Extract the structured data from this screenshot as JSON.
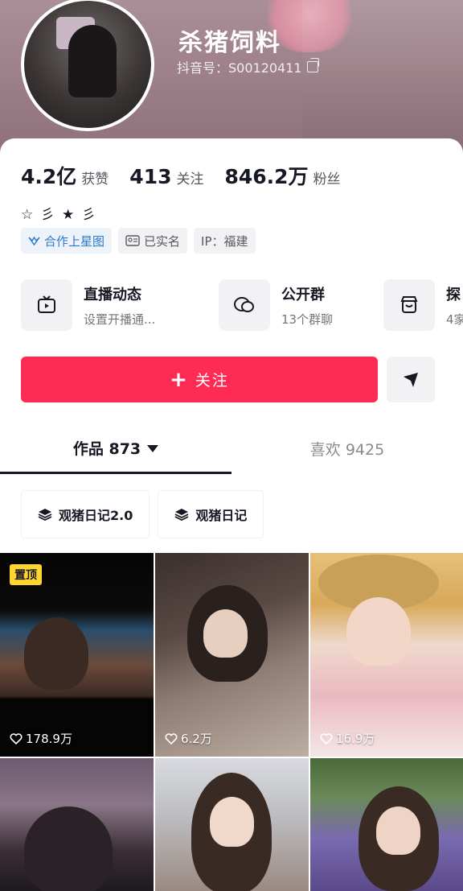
{
  "profile": {
    "nickname": "杀猪饲料",
    "douyin_id": "抖音号：S00120411"
  },
  "stats": [
    {
      "num": "4.2亿",
      "label": "获赞"
    },
    {
      "num": "413",
      "label": "关注"
    },
    {
      "num": "846.2万",
      "label": "粉丝"
    }
  ],
  "bio": "☆ 彡 ★ 彡",
  "tags": [
    {
      "label": "合作上星图",
      "icon": "star-map-icon"
    },
    {
      "label": "已实名",
      "icon": "id-card-icon"
    },
    {
      "label": "IP：福建",
      "icon": ""
    }
  ],
  "services": [
    {
      "title": "直播动态",
      "subtitle": "设置开播通...",
      "icon": "tv-icon"
    },
    {
      "title": "公开群",
      "subtitle": "13个群聊",
      "icon": "chat-bubble-icon"
    },
    {
      "title": "探",
      "subtitle": "4家",
      "icon": "store-icon"
    }
  ],
  "actions": {
    "follow_label": "关注",
    "follow_plus": "+",
    "share_icon": "send-icon"
  },
  "colors": {
    "accent": "#fe2c55",
    "pin_badge": "#ffd530",
    "star_tag": "#2a7ad0"
  },
  "tabs": [
    {
      "label": "作品 873",
      "active": true
    },
    {
      "label": "喜欢 9425",
      "active": false
    }
  ],
  "collections": [
    {
      "label": "观猪日记2.0",
      "icon": "layers-icon"
    },
    {
      "label": "观猪日记",
      "icon": "layers-icon"
    }
  ],
  "videos": [
    {
      "likes": "178.9万",
      "pinned": true,
      "pin_label": "置顶"
    },
    {
      "likes": "6.2万",
      "pinned": false
    },
    {
      "likes": "16.9万",
      "pinned": false
    },
    {
      "likes": "",
      "pinned": false
    },
    {
      "likes": "",
      "pinned": false
    },
    {
      "likes": "",
      "pinned": false
    }
  ]
}
